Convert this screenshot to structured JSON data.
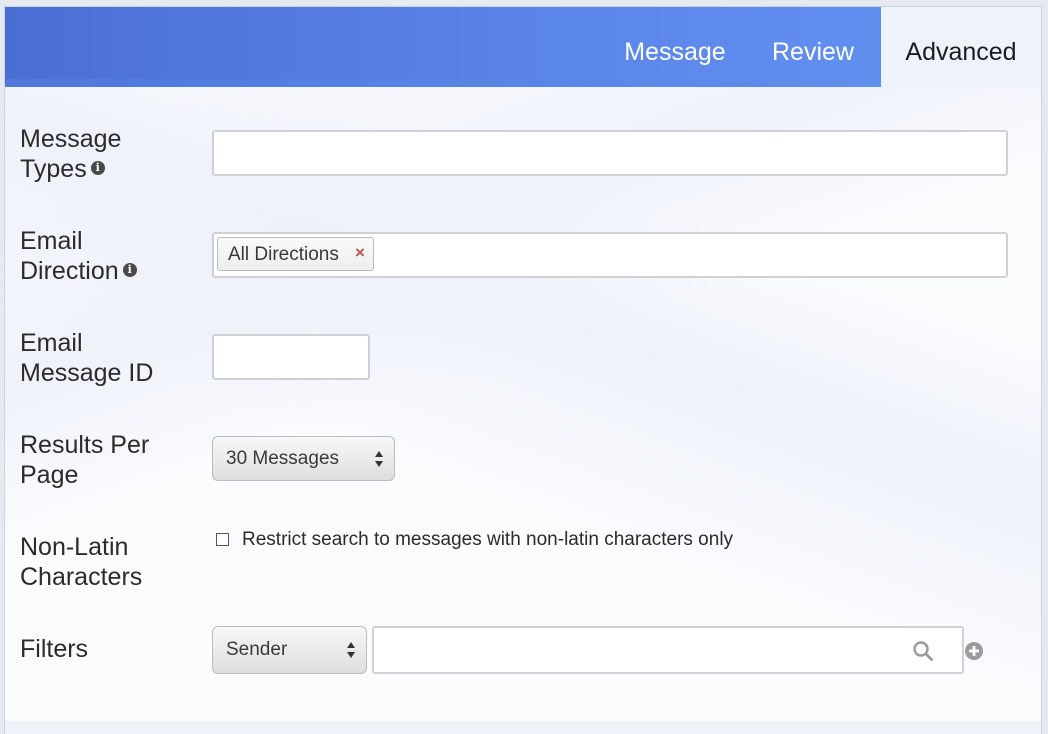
{
  "tabs": {
    "message": "Message",
    "review": "Review",
    "advanced": "Advanced"
  },
  "form": {
    "message_types": {
      "label_line1": "Message",
      "label_line2": "Types",
      "value": ""
    },
    "email_direction": {
      "label_line1": "Email",
      "label_line2": "Direction",
      "tag": "All Directions",
      "tag_remove": "×"
    },
    "email_message_id": {
      "label_line1": "Email",
      "label_line2": "Message ID",
      "value": ""
    },
    "results_per_page": {
      "label_line1": "Results Per",
      "label_line2": "Page",
      "selected": "30 Messages"
    },
    "non_latin": {
      "label_line1": "Non-Latin",
      "label_line2": "Characters",
      "checkbox_label": "Restrict search to messages with non-latin characters only",
      "checked": false
    },
    "filters": {
      "label": "Filters",
      "selected": "Sender",
      "value": ""
    }
  },
  "icons": {
    "info": "info-icon",
    "search": "search-icon",
    "add": "plus-circle-icon",
    "select_arrows": "select-arrows-icon"
  },
  "colors": {
    "header_start": "#4a6fd4",
    "header_end": "#6494f2",
    "active_tab_bg": "#eef2fb",
    "remove_x": "#c0504d"
  }
}
